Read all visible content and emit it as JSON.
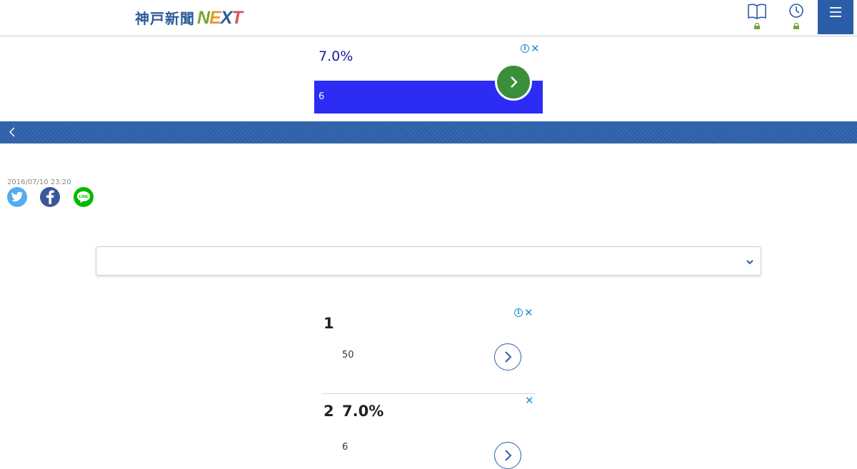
{
  "header": {
    "logo_jp": "神戸新聞",
    "logo_next": [
      "N",
      "E",
      "X",
      "T"
    ],
    "icons": [
      "book-icon",
      "clock-icon",
      "lock-icon",
      "menu-icon"
    ],
    "colors": {
      "brand_blue": "#2b5ea8",
      "lock_green": "#7aa53a"
    }
  },
  "ad_top": {
    "headline": "7.0%",
    "bar_text": "6",
    "colors": {
      "bar": "#2c2cf5",
      "button": "#3a8f3a"
    }
  },
  "article": {
    "date": "2016/07/10 23:20",
    "share": [
      "twitter",
      "facebook",
      "line"
    ]
  },
  "select": {
    "value": ""
  },
  "ads_ranked": [
    {
      "rank": "1",
      "title": "",
      "sub": "50"
    },
    {
      "rank": "2",
      "title": "7.0%",
      "sub": "6"
    }
  ]
}
